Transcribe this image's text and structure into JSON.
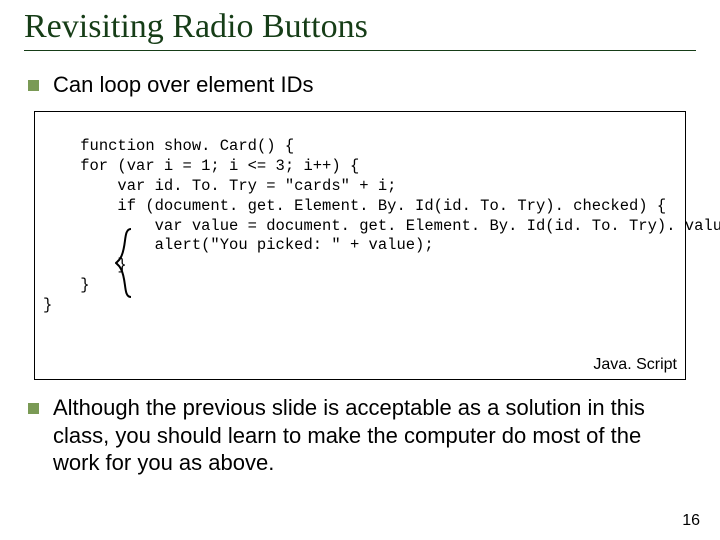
{
  "title": "Revisiting Radio Buttons",
  "bullets": {
    "first": "Can loop over element IDs",
    "second": "Although the previous slide is acceptable as a solution in this class, you should learn to make the computer do most of the work for you as above."
  },
  "code": {
    "text": "function show. Card() {\n    for (var i = 1; i <= 3; i++) {\n        var id. To. Try = \"cards\" + i;\n        if (document. get. Element. By. Id(id. To. Try). checked) {\n            var value = document. get. Element. By. Id(id. To. Try). value;\n            alert(\"You picked: \" + value);\n        }\n    }\n}",
    "language_label": "Java. Script"
  },
  "page_number": "16",
  "colors": {
    "title": "#163d17",
    "bullet": "#7a9a55"
  }
}
